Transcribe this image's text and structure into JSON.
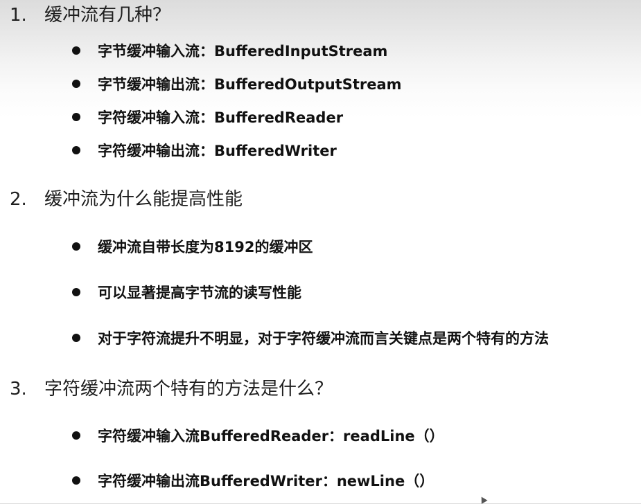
{
  "sections": [
    {
      "number": "1.",
      "title": "缓冲流有几种？",
      "items": [
        "字节缓冲输入流：BufferedInputStream",
        "字节缓冲输出流：BufferedOutputStream",
        "字符缓冲输入流：BufferedReader",
        "字符缓冲输出流：BufferedWriter"
      ]
    },
    {
      "number": "2.",
      "title": "缓冲流为什么能提高性能",
      "items": [
        "缓冲流自带长度为8192的缓冲区",
        "可以显著提高字节流的读写性能",
        "对于字符流提升不明显，对于字符缓冲流而言关键点是两个特有的方法"
      ]
    },
    {
      "number": "3.",
      "title": "字符缓冲流两个特有的方法是什么？",
      "items": [
        "字符缓冲输入流BufferedReader：readLine（）",
        "字符缓冲输出流BufferedWriter：newLine（）"
      ]
    }
  ]
}
